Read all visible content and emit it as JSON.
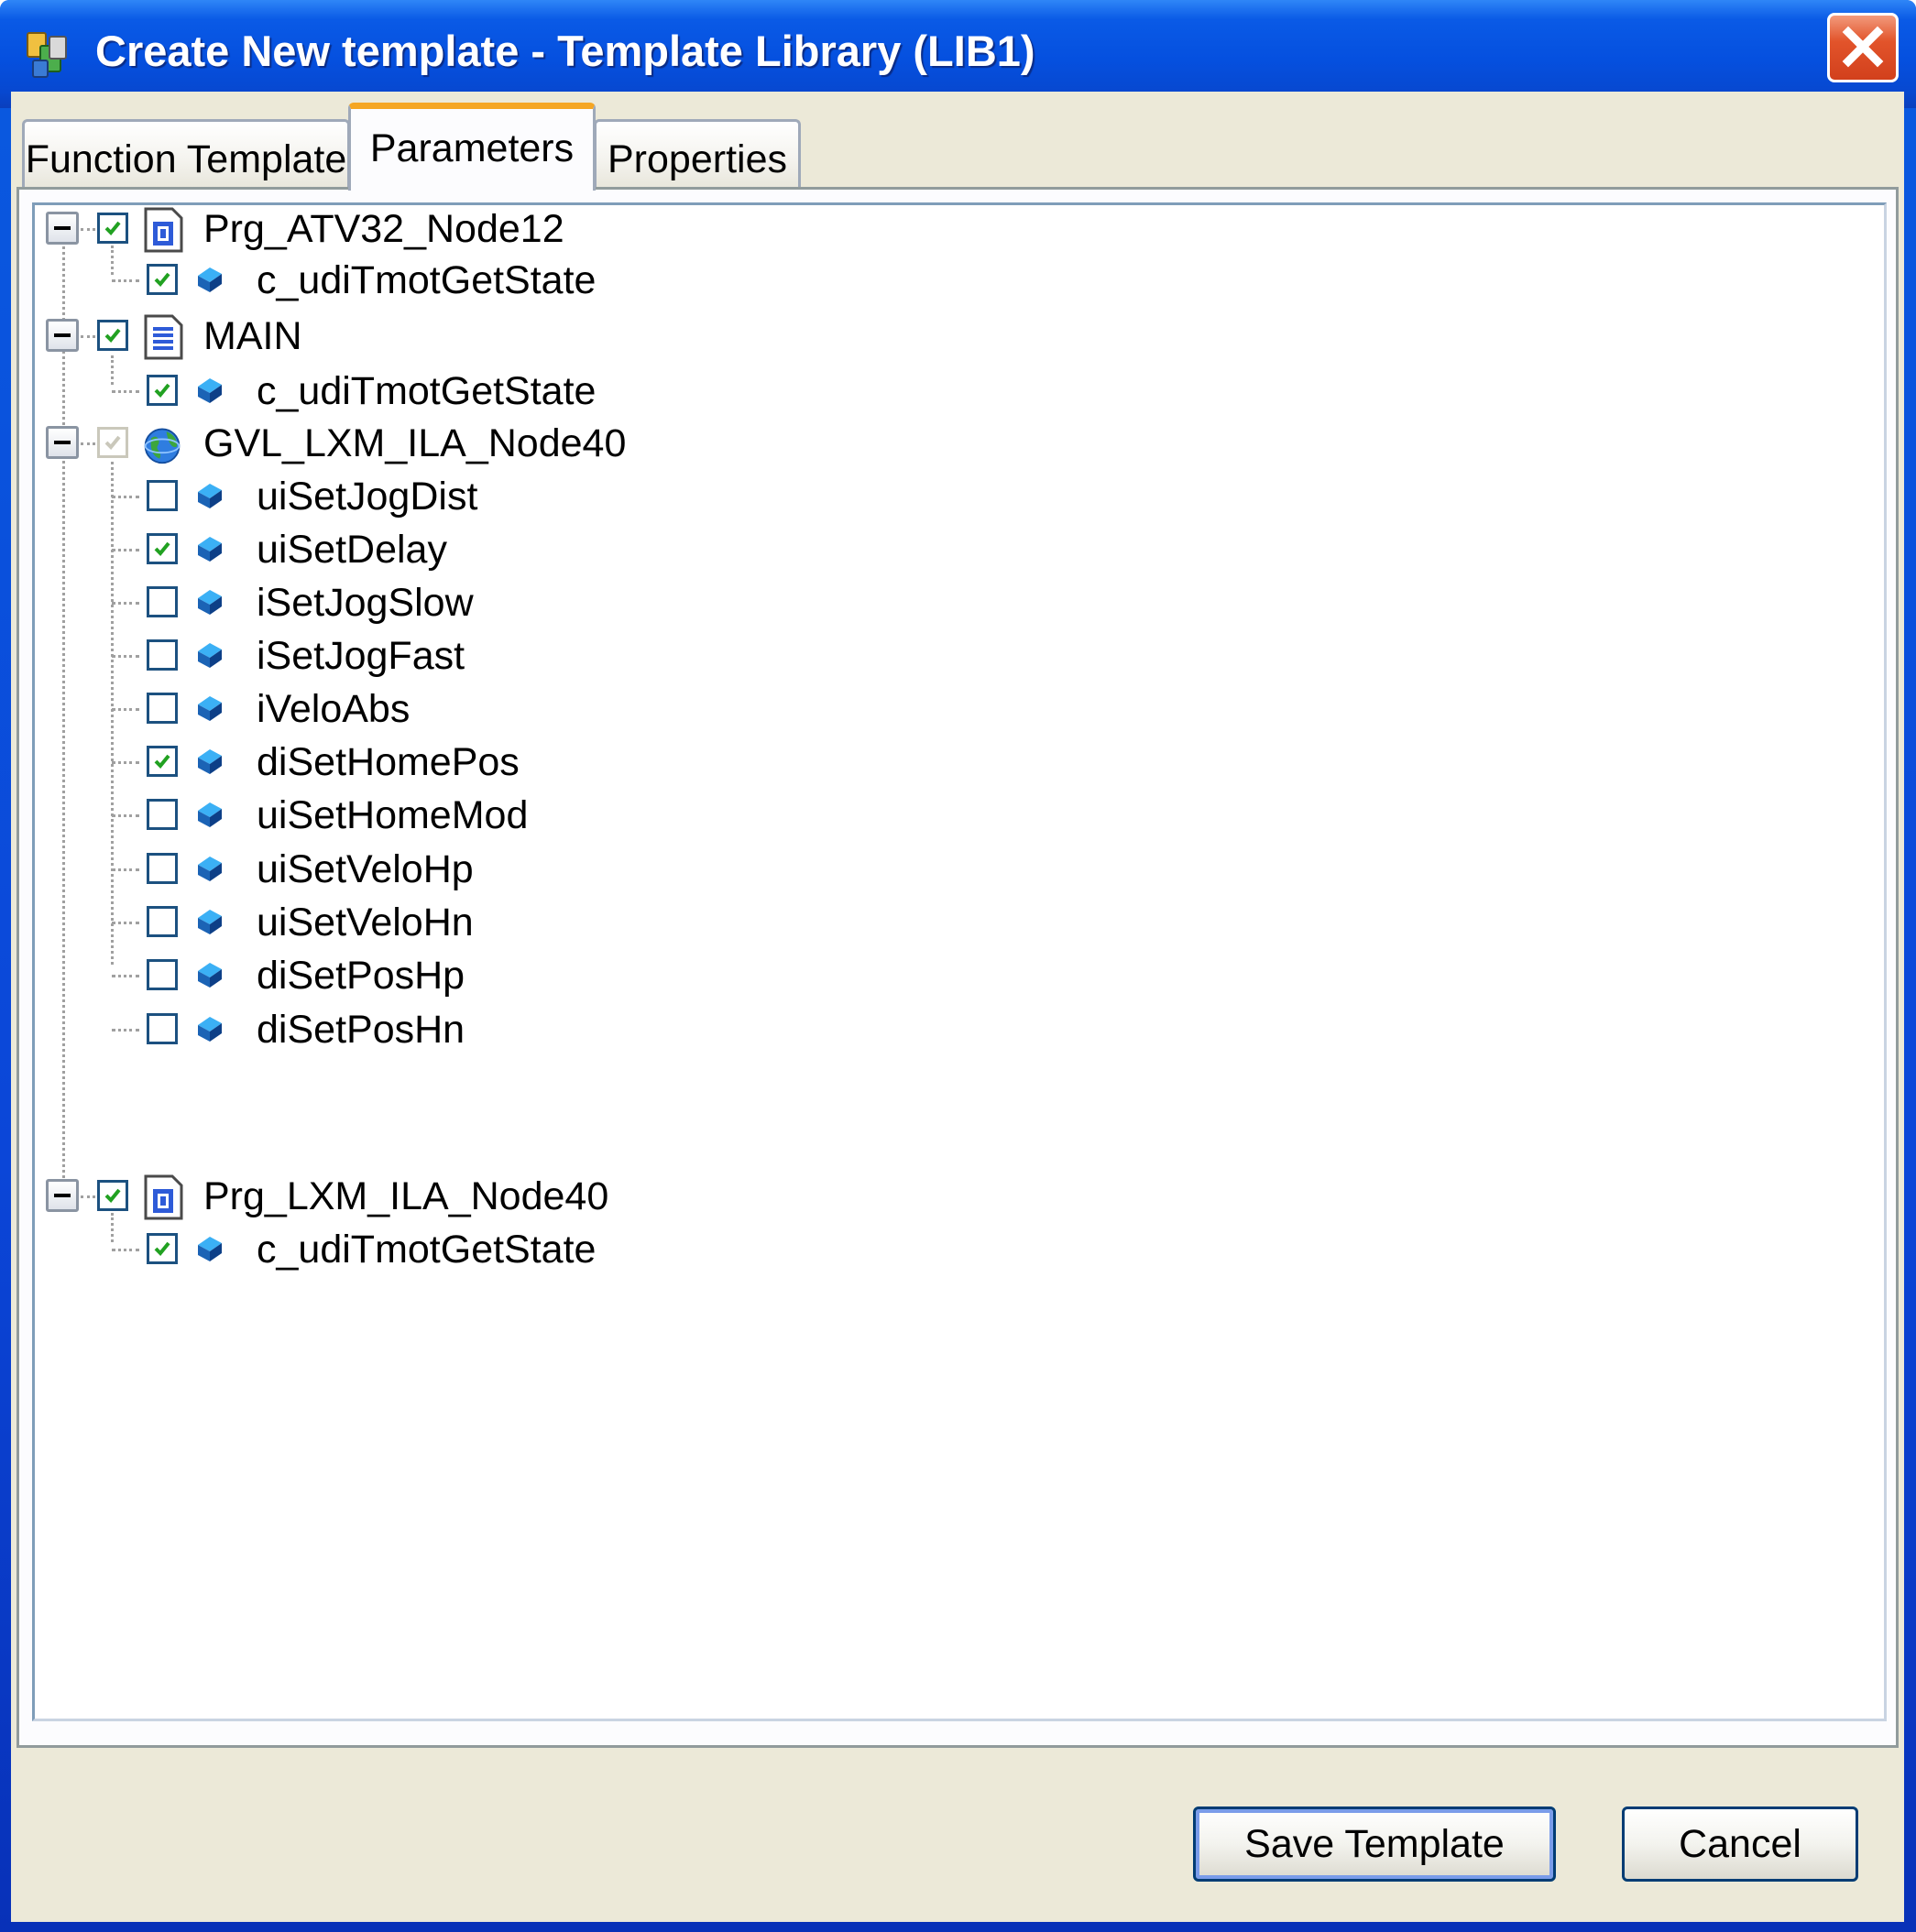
{
  "window": {
    "title": "Create New template - Template Library (LIB1)",
    "app_icon": "template-library-icon",
    "close_icon": "close-icon"
  },
  "tabs": [
    {
      "label": "Function Template",
      "active": false
    },
    {
      "label": "Parameters",
      "active": true
    },
    {
      "label": "Properties",
      "active": false
    }
  ],
  "tree": {
    "nodes": [
      {
        "name": "Prg_ATV32_Node12",
        "icon": "program-icon",
        "checked": true,
        "expanded": true,
        "children": [
          {
            "name": "c_udiTmotGetState",
            "icon": "variable-icon",
            "checked": true
          }
        ]
      },
      {
        "name": "MAIN",
        "icon": "document-icon",
        "checked": true,
        "expanded": true,
        "children": [
          {
            "name": "c_udiTmotGetState",
            "icon": "variable-icon",
            "checked": true
          }
        ]
      },
      {
        "name": "GVL_LXM_ILA_Node40",
        "icon": "global-variables-icon",
        "checked": true,
        "disabled": true,
        "expanded": true,
        "children": [
          {
            "name": "uiSetJogDist",
            "icon": "variable-icon",
            "checked": false
          },
          {
            "name": "uiSetDelay",
            "icon": "variable-icon",
            "checked": true
          },
          {
            "name": "iSetJogSlow",
            "icon": "variable-icon",
            "checked": false
          },
          {
            "name": "iSetJogFast",
            "icon": "variable-icon",
            "checked": false
          },
          {
            "name": "iVeloAbs",
            "icon": "variable-icon",
            "checked": false
          },
          {
            "name": "diSetHomePos",
            "icon": "variable-icon",
            "checked": true
          },
          {
            "name": "uiSetHomeMod",
            "icon": "variable-icon",
            "checked": false
          },
          {
            "name": "uiSetVeloHp",
            "icon": "variable-icon",
            "checked": false
          },
          {
            "name": "uiSetVeloHn",
            "icon": "variable-icon",
            "checked": false
          },
          {
            "name": "diSetPosHp",
            "icon": "variable-icon",
            "checked": false
          },
          {
            "name": "diSetPosHn",
            "icon": "variable-icon",
            "checked": false
          }
        ]
      },
      {
        "name": "Prg_LXM_ILA_Node40",
        "icon": "program-icon",
        "checked": true,
        "expanded": true,
        "children": [
          {
            "name": "c_udiTmotGetState",
            "icon": "variable-icon",
            "checked": true
          }
        ]
      }
    ]
  },
  "buttons": {
    "save_label": "Save Template",
    "cancel_label": "Cancel"
  },
  "colors": {
    "titlebar": "#0550df",
    "client_bg": "#ece9d8",
    "active_tab_accent": "#f5a623",
    "checkbox_border": "#1c5180",
    "checkmark": "#21a121",
    "button_border": "#003c74"
  }
}
